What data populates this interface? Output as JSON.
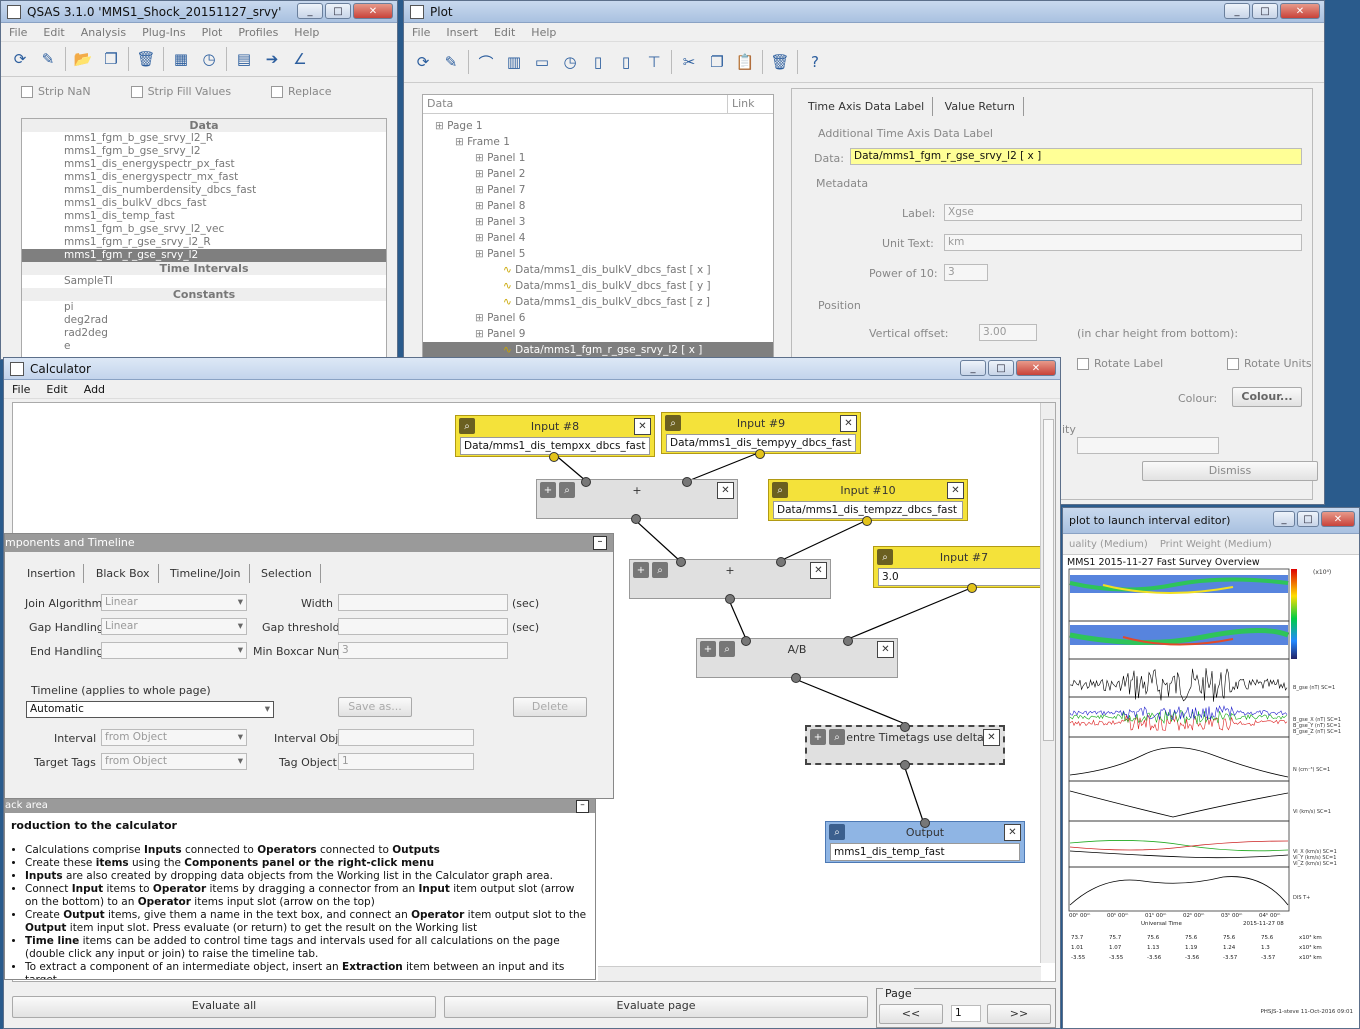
{
  "qsas": {
    "title": "QSAS 3.1.0   'MMS1_Shock_20151127_srvy'",
    "menu": [
      "File",
      "Edit",
      "Analysis",
      "Plug-Ins",
      "Plot",
      "Profiles",
      "Help"
    ],
    "strip_nan": "Strip NaN",
    "strip_fill": "Strip Fill Values",
    "replace": "Replace",
    "data_header": "Data",
    "data_items": [
      "mms1_fgm_b_gse_srvy_l2_R",
      "mms1_fgm_b_gse_srvy_l2",
      "mms1_dis_energyspectr_px_fast",
      "mms1_dis_energyspectr_mx_fast",
      "mms1_dis_numberdensity_dbcs_fast",
      "mms1_dis_bulkV_dbcs_fast",
      "mms1_dis_temp_fast",
      "mms1_fgm_b_gse_srvy_l2_vec",
      "mms1_fgm_r_gse_srvy_l2_R",
      "mms1_fgm_r_gse_srvy_l2"
    ],
    "time_header": "Time Intervals",
    "time_items": [
      "SampleTI"
    ],
    "const_header": "Constants",
    "const_items": [
      "pi",
      "deg2rad",
      "rad2deg",
      "e"
    ]
  },
  "plot": {
    "title": "Plot",
    "menu": [
      "File",
      "Insert",
      "Edit",
      "Help"
    ],
    "col_data": "Data",
    "col_link": "Link",
    "tree": [
      "Page 1",
      "Frame 1",
      "Panel 1",
      "Panel 2",
      "Panel 7",
      "Panel 8",
      "Panel 3",
      "Panel 4",
      "Panel 5",
      "Data/mms1_dis_bulkV_dbcs_fast [ x ]",
      "Data/mms1_dis_bulkV_dbcs_fast [ y ]",
      "Data/mms1_dis_bulkV_dbcs_fast [ z ]",
      "Panel 6",
      "Panel 9",
      "Data/mms1_fgm_r_gse_srvy_l2 [ x ]"
    ],
    "tab_time_axis": "Time Axis Data Label",
    "tab_value_return": "Value Return",
    "group_additional": "Additional Time Axis Data Label",
    "data_label": "Data:",
    "data_value": "Data/mms1_fgm_r_gse_srvy_l2 [ x ]",
    "group_metadata": "Metadata",
    "label_label": "Label:",
    "label_value": "Xgse",
    "unit_label": "Unit Text:",
    "unit_value": "km",
    "power_label": "Power of 10:",
    "power_value": "3",
    "group_position": "Position",
    "voffset_label": "Vertical offset:",
    "voffset_value": "3.00",
    "char_note": "(in char height from bottom):",
    "rotate_label": "Rotate Label",
    "rotate_units": "Rotate Units",
    "colour_label": "Colour:",
    "colour_button": "Colour...",
    "dismiss": "Dismiss",
    "ity": "ity"
  },
  "plotview": {
    "title_frag": "plot to launch interval editor)",
    "quality": "uality (Medium)",
    "print_weight": "Print Weight (Medium)",
    "chart_title": "MMS1 2015-11-27 Fast Survey Overview",
    "cbar_label": "(x10⁴)",
    "side_labels": [
      "B_gse (nT) SC=1",
      "B_gse_X (nT) SC=1",
      "B_gse_Y (nT) SC=1",
      "B_gse_Z (nT) SC=1",
      "N (cm⁻³) SC=1",
      "Vi (km/s) SC=1",
      "Vi_X (km/s) SC=1",
      "Vi_Y (km/s) SC=1",
      "Vi_Z (km/s) SC=1",
      "DIS T+"
    ],
    "time_ticks": [
      "00ʰ 00ᵐ",
      "00ʰ 00ᵐ",
      "01ʰ 00ᵐ",
      "02ʰ 00ᵐ",
      "03ʰ 00ᵐ",
      "04ʰ 00ᵐ"
    ],
    "universal_time": "Universal Time",
    "date_note": "2015-11-27 08",
    "rows": [
      [
        "73.7",
        "75.7",
        "75.6",
        "75.6",
        "75.6",
        "75.6"
      ],
      [
        "1.01",
        "1.07",
        "1.13",
        "1.19",
        "1.24",
        "1.3"
      ],
      [
        "-3.55",
        "-3.55",
        "-3.56",
        "-3.56",
        "-3.57",
        "-3.57"
      ]
    ],
    "row_units": [
      "x10³ km",
      "x10³ km",
      "x10³ km"
    ],
    "footer": "PHSJS-1-steve 11-Oct-2016 09:01"
  },
  "calc": {
    "title": "Calculator",
    "menu": [
      "File",
      "Edit",
      "Add"
    ],
    "components_title": "mponents and Timeline",
    "tabs": [
      "Insertion",
      "Black Box",
      "Timeline/Join",
      "Selection"
    ],
    "join_label": "Join Algorithm",
    "join_value": "Linear",
    "gap_label": "Gap Handling",
    "gap_value": "Linear",
    "end_label": "End Handling",
    "end_value": "",
    "width_label": "Width",
    "width_unit": "(sec)",
    "gap_thresh_label": "Gap threshold",
    "gap_thresh_unit": "(sec)",
    "boxcar_label": "Min Boxcar Num",
    "boxcar_value": "3",
    "timeline_label": "Timeline  (applies to whole page)",
    "timeline_value": "Automatic",
    "save_as": "Save as...",
    "delete": "Delete",
    "interval_label": "Interval",
    "interval_value": "from Object",
    "interval_obj_label": "Interval Obj",
    "target_tags_label": "Target Tags",
    "target_tags_value": "from Object",
    "tag_object_label": "Tag Object",
    "tag_object_value": "1",
    "scratch_title": "ack area",
    "help_title": "roduction to the calculator",
    "help": [
      {
        "parts": [
          "Calculations comprise ",
          "Inputs",
          " connected to ",
          "Operators",
          " connected to ",
          "Outputs"
        ]
      },
      {
        "parts": [
          "Create these ",
          "items",
          " using the ",
          "Components panel or the right-click menu",
          ""
        ]
      },
      {
        "parts": [
          "",
          "Inputs",
          " are also created by dropping data objects from the Working list in the Calculator graph area."
        ]
      },
      {
        "parts": [
          "Connect ",
          "Input",
          " items to ",
          "Operator",
          " items by dragging a connector from an ",
          "Input",
          " item output slot (arrow on the bottom) to an ",
          "Operator",
          " items input slot (arrow on the top)"
        ]
      },
      {
        "parts": [
          "Create ",
          "Output",
          " items, give them a name in the text box, and connect an ",
          "Operator",
          " item output slot to the ",
          "Output",
          " item input slot. Press evaluate (or return) to get the result on the Working list"
        ]
      },
      {
        "parts": [
          "",
          "Time line",
          " items can be added to control time tags and intervals used for all calculations on the page (double click any input or join) to raise the timeline tab."
        ]
      },
      {
        "parts": [
          "To extract a component of an intermediate object, insert an ",
          "Extraction",
          " item between an input and its target"
        ]
      }
    ],
    "evaluate_all": "Evaluate all",
    "evaluate_page": "Evaluate page",
    "page_label": "Page",
    "prev": "<<",
    "page_num": "1",
    "next": ">>",
    "nodes": {
      "input8": {
        "title": "Input #8",
        "value": "Data/mms1_dis_tempxx_dbcs_fast"
      },
      "input9": {
        "title": "Input #9",
        "value": "Data/mms1_dis_tempyy_dbcs_fast"
      },
      "input10": {
        "title": "Input #10",
        "value": "Data/mms1_dis_tempzz_dbcs_fast"
      },
      "input7": {
        "title": "Input #7",
        "value": "3.0"
      },
      "plus1": {
        "title": "+"
      },
      "plus2": {
        "title": "+"
      },
      "div": {
        "title": "A/B"
      },
      "centre": {
        "title": "entre Timetags use delta"
      },
      "output": {
        "title": "Output",
        "value": "mms1_dis_temp_fast"
      }
    }
  }
}
